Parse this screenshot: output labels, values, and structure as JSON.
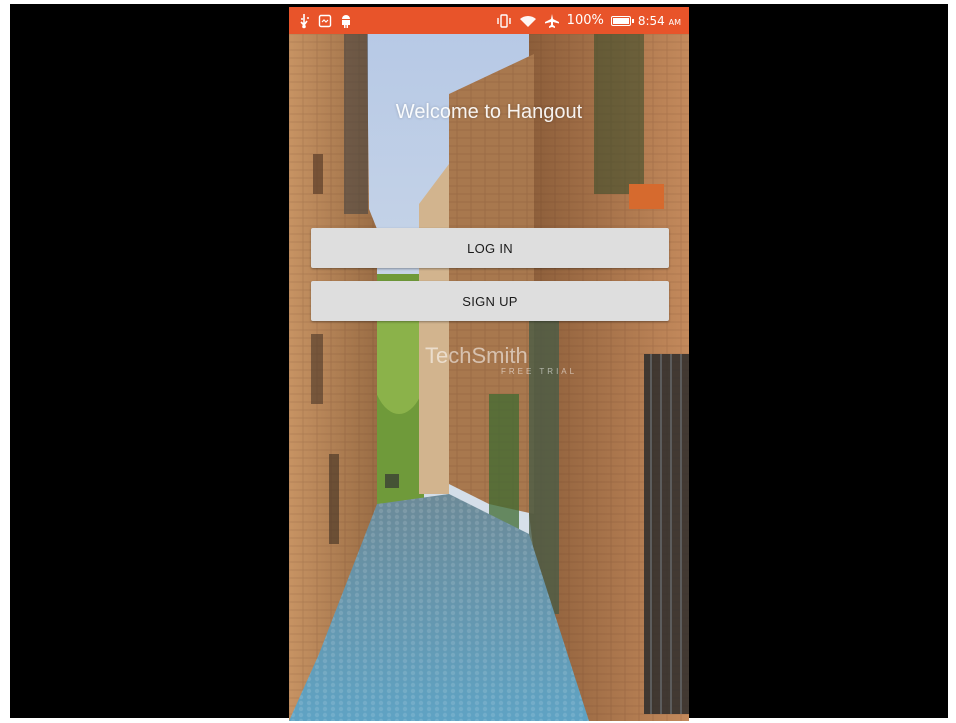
{
  "status_bar": {
    "left_icons": [
      "usb-icon",
      "screenshot-icon",
      "android-icon"
    ],
    "right_icons": [
      "vibrate-icon",
      "wifi-icon",
      "airplane-icon"
    ],
    "battery": "100%",
    "time": "8:54",
    "ampm": "AM"
  },
  "screen": {
    "title": "Welcome to Hangout",
    "login_label": "LOG IN",
    "signup_label": "SIGN UP"
  },
  "watermark": {
    "name": "TechSmith",
    "sub": "FREE TRIAL"
  },
  "colors": {
    "status_bar": "#e8542a",
    "button_bg": "#dedede",
    "frame": "#000000"
  }
}
